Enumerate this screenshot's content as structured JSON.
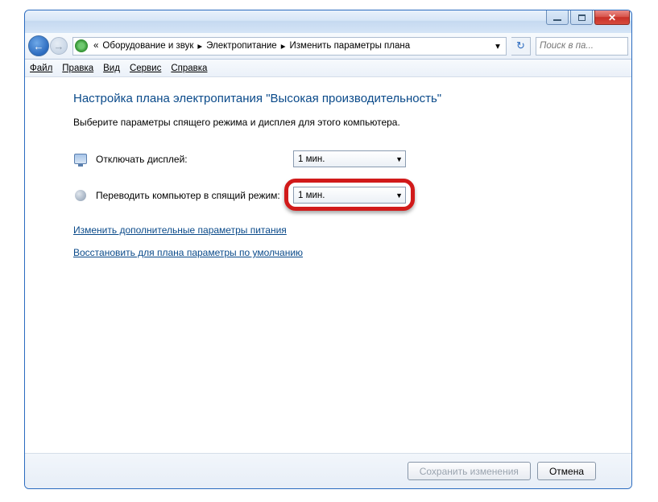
{
  "titlebar": {},
  "breadcrumb": {
    "level1": "Оборудование и звук",
    "level2": "Электропитание",
    "level3": "Изменить параметры плана"
  },
  "search": {
    "placeholder": "Поиск в па..."
  },
  "menu": {
    "file": "Файл",
    "edit": "Правка",
    "view": "Вид",
    "service": "Сервис",
    "help": "Справка"
  },
  "main": {
    "heading": "Настройка плана электропитания \"Высокая производительность\"",
    "subtext": "Выберите параметры спящего режима и дисплея для этого компьютера.",
    "settings": [
      {
        "label": "Отключать дисплей:",
        "value": "1 мин."
      },
      {
        "label": "Переводить компьютер в спящий режим:",
        "value": "1 мин."
      }
    ],
    "link_advanced": "Изменить дополнительные параметры питания",
    "link_restore": "Восстановить для плана параметры по умолчанию"
  },
  "footer": {
    "save": "Сохранить изменения",
    "cancel": "Отмена"
  }
}
